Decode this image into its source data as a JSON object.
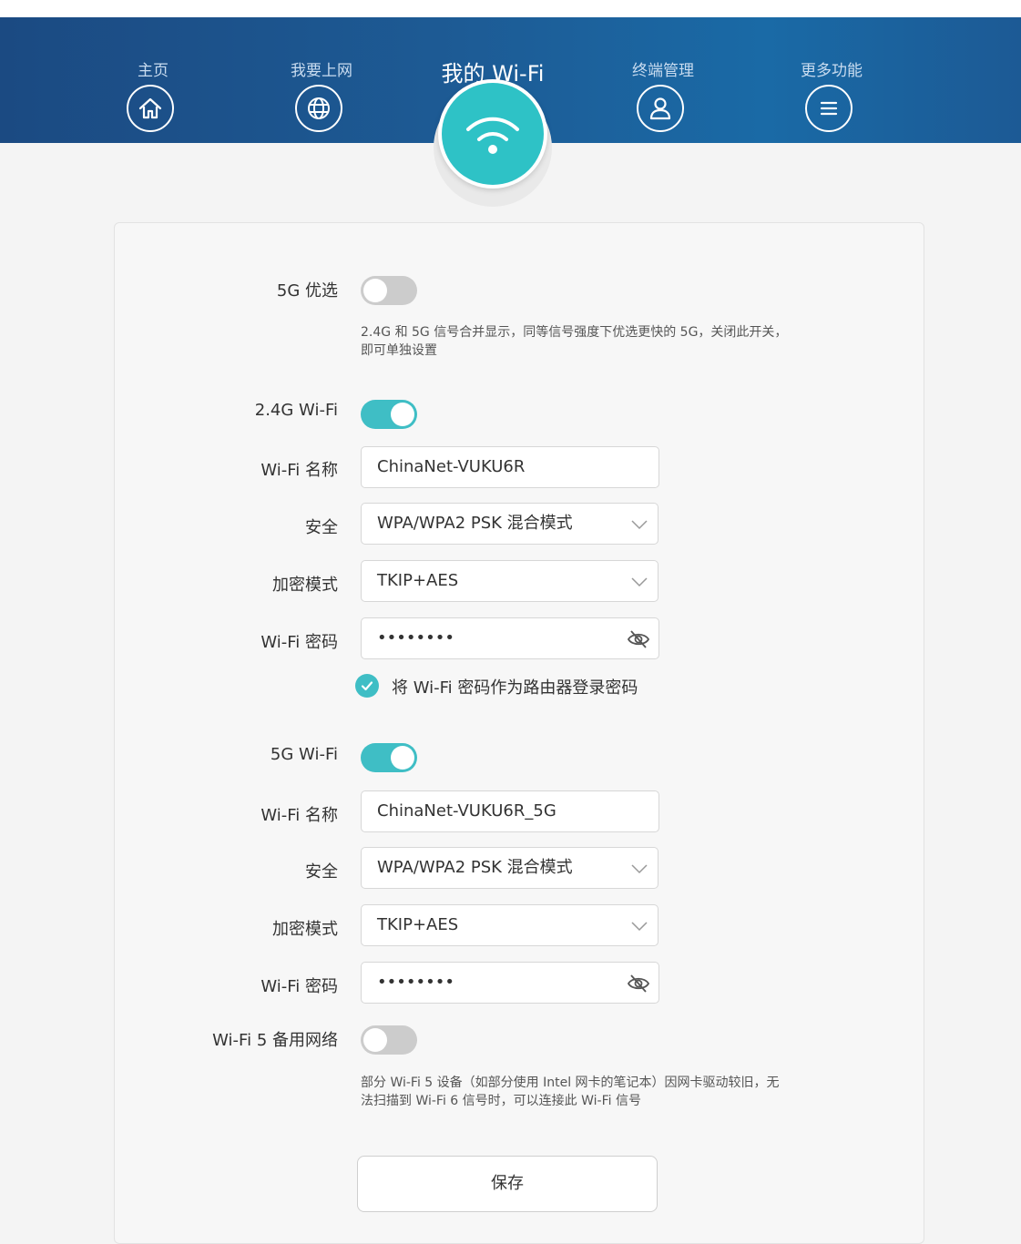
{
  "nav": {
    "home": "主页",
    "internet": "我要上网",
    "mywifi": "我的 Wi-Fi",
    "devices": "终端管理",
    "more": "更多功能"
  },
  "settings": {
    "pref5g": {
      "label": "5G 优选",
      "on": false,
      "hint": "2.4G 和 5G 信号合并显示，同等信号强度下优选更快的 5G，关闭此开关，即可单独设置"
    },
    "wifi24": {
      "label": "2.4G Wi-Fi",
      "on": true,
      "name_label": "Wi-Fi 名称",
      "name_value": "ChinaNet-VUKU6R",
      "security_label": "安全",
      "security_value": "WPA/WPA2 PSK 混合模式",
      "encryption_label": "加密模式",
      "encryption_value": "TKIP+AES",
      "password_label": "Wi-Fi 密码",
      "password_mask": "••••••••",
      "use_as_login_label": "将 Wi-Fi 密码作为路由器登录密码",
      "use_as_login_checked": true
    },
    "wifi5": {
      "label": "5G Wi-Fi",
      "on": true,
      "name_label": "Wi-Fi 名称",
      "name_value": "ChinaNet-VUKU6R_5G",
      "security_label": "安全",
      "security_value": "WPA/WPA2 PSK 混合模式",
      "encryption_label": "加密模式",
      "encryption_value": "TKIP+AES",
      "password_label": "Wi-Fi 密码",
      "password_mask": "••••••••"
    },
    "wifi5backup": {
      "label": "Wi-Fi 5 备用网络",
      "on": false,
      "hint": "部分 Wi-Fi 5 设备（如部分使用 Intel 网卡的笔记本）因网卡驱动较旧，无法扫描到 Wi-Fi 6 信号时，可以连接此 Wi-Fi 信号"
    },
    "save_label": "保存"
  },
  "colors": {
    "accent": "#3fbec5",
    "nav_bg": "#1d5b95",
    "toggle_off": "#cccccc"
  },
  "icons": [
    "home-icon",
    "globe-icon",
    "wifi-icon",
    "user-icon",
    "menu-icon",
    "chevron-down-icon",
    "eye-hidden-icon",
    "check-icon"
  ]
}
